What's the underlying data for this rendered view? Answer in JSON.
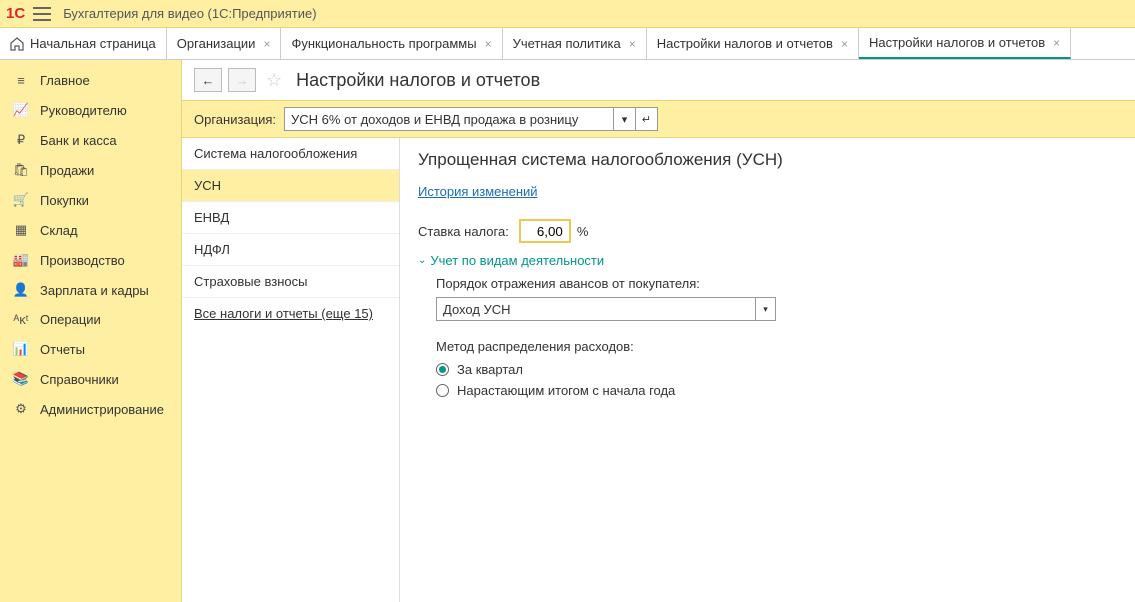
{
  "titlebar": {
    "logo": "1C",
    "app_title": "Бухгалтерия для видео  (1С:Предприятие)"
  },
  "tabs": [
    {
      "label": "Начальная страница",
      "home": true
    },
    {
      "label": "Организации"
    },
    {
      "label": "Функциональность программы"
    },
    {
      "label": "Учетная политика"
    },
    {
      "label": "Настройки налогов и отчетов"
    },
    {
      "label": "Настройки налогов и отчетов",
      "active": true
    }
  ],
  "sidebar": {
    "items": [
      {
        "icon": "≡",
        "label": "Главное"
      },
      {
        "icon": "📈",
        "label": "Руководителю"
      },
      {
        "icon": "₽",
        "label": "Банк и касса"
      },
      {
        "icon": "🛍",
        "label": "Продажи"
      },
      {
        "icon": "🛒",
        "label": "Покупки"
      },
      {
        "icon": "▦",
        "label": "Склад"
      },
      {
        "icon": "🏭",
        "label": "Производство"
      },
      {
        "icon": "👤",
        "label": "Зарплата и кадры"
      },
      {
        "icon": "ᴬᴋᵗ",
        "label": "Операции"
      },
      {
        "icon": "📊",
        "label": "Отчеты"
      },
      {
        "icon": "📚",
        "label": "Справочники"
      },
      {
        "icon": "⚙",
        "label": "Администрирование"
      }
    ]
  },
  "page": {
    "title": "Настройки налогов и отчетов",
    "org_label": "Организация:",
    "org_value": "УСН 6% от доходов и ЕНВД продажа в розницу"
  },
  "categories": {
    "items": [
      {
        "label": "Система налогообложения"
      },
      {
        "label": "УСН",
        "selected": true
      },
      {
        "label": "ЕНВД"
      },
      {
        "label": "НДФЛ"
      },
      {
        "label": "Страховые взносы"
      }
    ],
    "all_link": "Все налоги и отчеты (еще 15)"
  },
  "content": {
    "heading": "Упрощенная система налогообложения (УСН)",
    "history_link": "История изменений",
    "rate_label": "Ставка налога:",
    "rate_value": "6,00",
    "rate_unit": "%",
    "section_title": "Учет по видам деятельности",
    "advance_label": "Порядок отражения авансов от покупателя:",
    "advance_value": "Доход УСН",
    "method_label": "Метод распределения расходов:",
    "radio1": "За квартал",
    "radio2": "Нарастающим итогом с начала года"
  }
}
